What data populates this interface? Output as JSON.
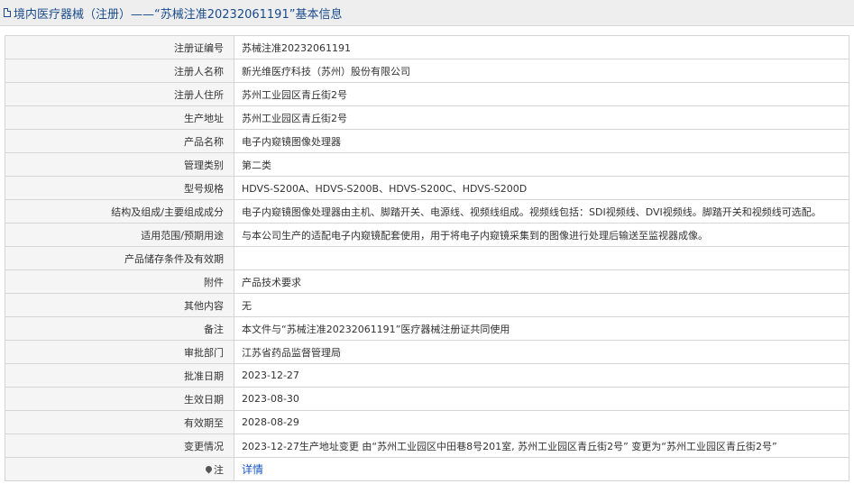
{
  "page": {
    "title": "境内医疗器械（注册）——“苏械注准20232061191”基本信息",
    "icon": "document-icon"
  },
  "rows": [
    {
      "label": "注册证编号",
      "value": "苏械注准20232061191"
    },
    {
      "label": "注册人名称",
      "value": "新光维医疗科技（苏州）股份有限公司"
    },
    {
      "label": "注册人住所",
      "value": "苏州工业园区青丘街2号"
    },
    {
      "label": "生产地址",
      "value": "苏州工业园区青丘街2号"
    },
    {
      "label": "产品名称",
      "value": "电子内窥镜图像处理器"
    },
    {
      "label": "管理类别",
      "value": "第二类"
    },
    {
      "label": "型号规格",
      "value": "HDVS-S200A、HDVS-S200B、HDVS-S200C、HDVS-S200D"
    },
    {
      "label": "结构及组成/主要组成成分",
      "value": "电子内窥镜图像处理器由主机、脚踏开关、电源线、视频线组成。视频线包括：SDI视频线、DVI视频线。脚踏开关和视频线可选配。"
    },
    {
      "label": "适用范围/预期用途",
      "value": "与本公司生产的适配电子内窥镜配套使用，用于将电子内窥镜采集到的图像进行处理后输送至监视器成像。"
    },
    {
      "label": "产品储存条件及有效期",
      "value": ""
    },
    {
      "label": "附件",
      "value": "产品技术要求"
    },
    {
      "label": "其他内容",
      "value": "无"
    },
    {
      "label": "备注",
      "value": "本文件与“苏械注准20232061191”医疗器械注册证共同使用"
    },
    {
      "label": "审批部门",
      "value": "江苏省药品监督管理局"
    },
    {
      "label": "批准日期",
      "value": "2023-12-27"
    },
    {
      "label": "生效日期",
      "value": "2023-08-30"
    },
    {
      "label": "有效期至",
      "value": "2028-08-29"
    },
    {
      "label": "变更情况",
      "value": "2023-12-27生产地址变更 由“苏州工业园区中田巷8号201室, 苏州工业园区青丘街2号” 变更为“苏州工业园区青丘街2号”"
    }
  ],
  "note": {
    "label": "注",
    "icon": "location-pin-icon",
    "link_text": "详情"
  },
  "colors": {
    "title_text": "#1a4b8c",
    "title_bg": "#eeeeee",
    "label_bg": "#f5f5f5",
    "border": "#d5d5d5",
    "link": "#1a56c4"
  }
}
